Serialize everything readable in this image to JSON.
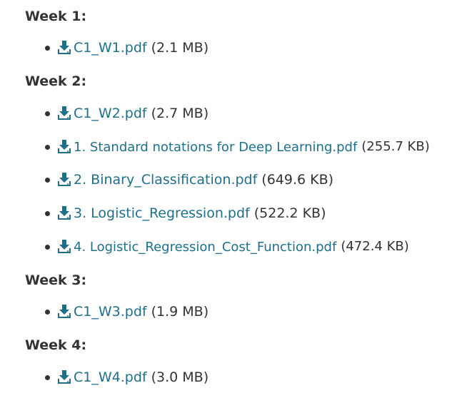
{
  "icons": {
    "download": "download-icon",
    "link_color": "#1f6f8b",
    "text_color": "#333333"
  },
  "weeks": [
    {
      "heading": "Week 1:",
      "files": [
        {
          "name": "C1_W1.pdf",
          "size": "(2.1 MB)"
        }
      ]
    },
    {
      "heading": "Week 2:",
      "files": [
        {
          "name": "C1_W2.pdf",
          "size": "(2.7 MB)"
        },
        {
          "name": "1. Standard notations for Deep Learning.pdf",
          "size": "(255.7 KB)"
        },
        {
          "name": "2. Binary_Classification.pdf",
          "size": "(649.6 KB)"
        },
        {
          "name": "3. Logistic_Regression.pdf",
          "size": "(522.2 KB)"
        },
        {
          "name": "4. Logistic_Regression_Cost_Function.pdf",
          "size": "(472.4 KB)"
        }
      ]
    },
    {
      "heading": "Week 3:",
      "files": [
        {
          "name": "C1_W3.pdf",
          "size": "(1.9 MB)"
        }
      ]
    },
    {
      "heading": "Week 4:",
      "files": [
        {
          "name": "C1_W4.pdf",
          "size": "(3.0 MB)"
        }
      ]
    }
  ]
}
